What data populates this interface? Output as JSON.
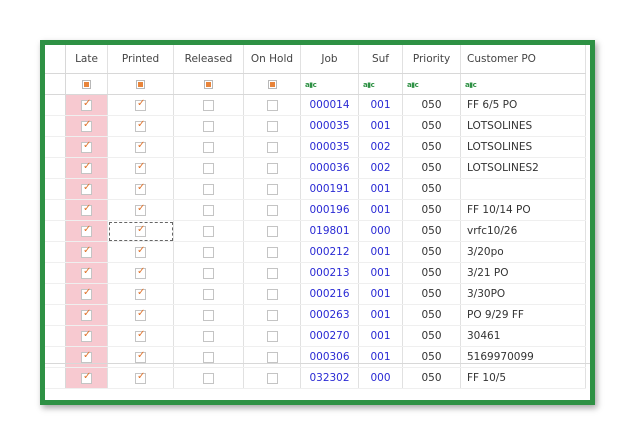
{
  "columns": [
    "Late",
    "Printed",
    "Released",
    "On Hold",
    "Job",
    "Suf",
    "Priority",
    "Customer PO"
  ],
  "filter_icon": "filter-text-icon",
  "colors": {
    "frame": "#2e9144",
    "late_highlight": "#f7c9d0",
    "check": "#e0732c",
    "link": "#2a2ad4"
  },
  "rows": [
    {
      "late": true,
      "printed": true,
      "released": false,
      "on_hold": false,
      "job": "000014",
      "suf": "001",
      "priority": "050",
      "customer_po": "FF 6/5 PO"
    },
    {
      "late": true,
      "printed": true,
      "released": false,
      "on_hold": false,
      "job": "000035",
      "suf": "001",
      "priority": "050",
      "customer_po": "LOTSOLINES"
    },
    {
      "late": true,
      "printed": true,
      "released": false,
      "on_hold": false,
      "job": "000035",
      "suf": "002",
      "priority": "050",
      "customer_po": "LOTSOLINES"
    },
    {
      "late": true,
      "printed": true,
      "released": false,
      "on_hold": false,
      "job": "000036",
      "suf": "002",
      "priority": "050",
      "customer_po": "LOTSOLINES2"
    },
    {
      "late": true,
      "printed": true,
      "released": false,
      "on_hold": false,
      "job": "000191",
      "suf": "001",
      "priority": "050",
      "customer_po": ""
    },
    {
      "late": true,
      "printed": true,
      "released": false,
      "on_hold": false,
      "job": "000196",
      "suf": "001",
      "priority": "050",
      "customer_po": "FF 10/14 PO"
    },
    {
      "late": true,
      "printed": true,
      "released": false,
      "on_hold": false,
      "job": "019801",
      "suf": "000",
      "priority": "050",
      "customer_po": "vrfc10/26"
    },
    {
      "late": true,
      "printed": true,
      "released": false,
      "on_hold": false,
      "job": "000212",
      "suf": "001",
      "priority": "050",
      "customer_po": "3/20po"
    },
    {
      "late": true,
      "printed": true,
      "released": false,
      "on_hold": false,
      "job": "000213",
      "suf": "001",
      "priority": "050",
      "customer_po": "3/21 PO"
    },
    {
      "late": true,
      "printed": true,
      "released": false,
      "on_hold": false,
      "job": "000216",
      "suf": "001",
      "priority": "050",
      "customer_po": "3/30PO"
    },
    {
      "late": true,
      "printed": true,
      "released": false,
      "on_hold": false,
      "job": "000263",
      "suf": "001",
      "priority": "050",
      "customer_po": "PO 9/29 FF"
    },
    {
      "late": true,
      "printed": true,
      "released": false,
      "on_hold": false,
      "job": "000270",
      "suf": "001",
      "priority": "050",
      "customer_po": "30461"
    },
    {
      "late": true,
      "printed": true,
      "released": false,
      "on_hold": false,
      "job": "000306",
      "suf": "001",
      "priority": "050",
      "customer_po": "5169970099"
    },
    {
      "late": true,
      "printed": true,
      "released": false,
      "on_hold": false,
      "job": "032302",
      "suf": "000",
      "priority": "050",
      "customer_po": "FF 10/5"
    }
  ]
}
